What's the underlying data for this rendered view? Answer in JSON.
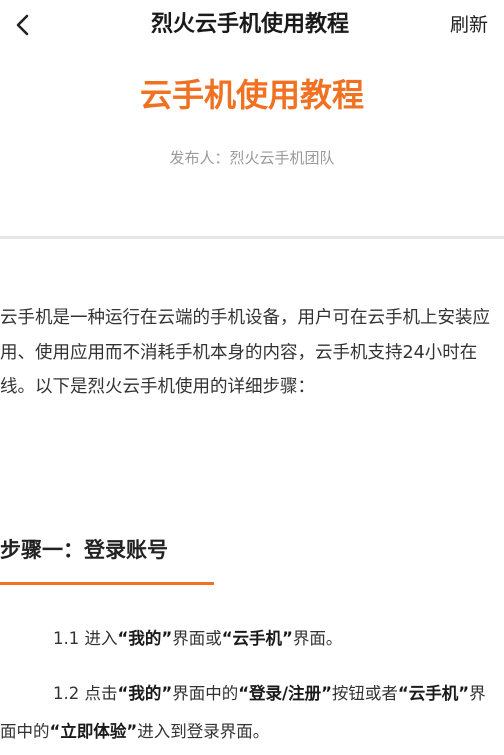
{
  "topbar": {
    "title": "烈火云手机使用教程",
    "refresh_label": "刷新",
    "back_icon": "chevron-left-icon"
  },
  "article": {
    "title": "云手机使用教程",
    "publisher": "发布人：烈火云手机团队",
    "intro": "云手机是一种运行在云端的手机设备，用户可在云手机上安装应用、使用应用而不消耗手机本身的内容，云手机支持24小时在线。以下是烈火云手机使用的详细步骤：",
    "section1": {
      "heading": "步骤一：登录账号",
      "step1": {
        "prefix": "1.1 进入",
        "bold1": "“我的”",
        "mid1": "界面或",
        "bold2": "“云手机”",
        "suffix": "界面。"
      },
      "step2": {
        "prefix": "1.2 点击",
        "bold1": "“我的”",
        "mid1": "界面中的",
        "bold2": "“登录/注册”",
        "mid2": "按钮或者",
        "bold3": "“云手机”",
        "mid3": "界面中的",
        "bold4": "“立即体验”",
        "suffix": "进入到登录界面。"
      }
    }
  },
  "colors": {
    "accent": "#f07122",
    "muted": "#9a9a9a",
    "divider": "#e6e6e6"
  }
}
